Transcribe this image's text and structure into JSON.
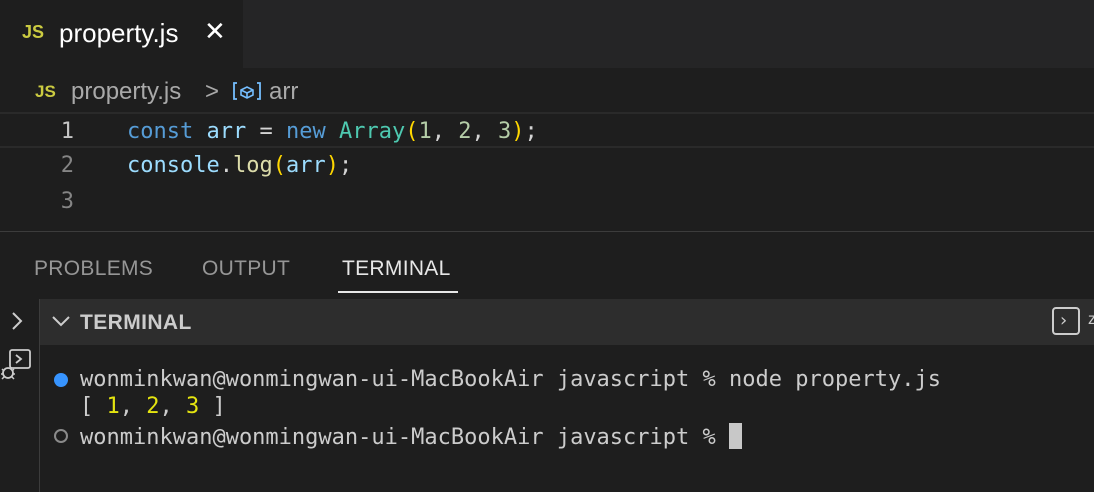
{
  "tab": {
    "lang_badge": "JS",
    "filename": "property.js",
    "close_glyph": "✕"
  },
  "breadcrumb": {
    "lang_badge": "JS",
    "file": "property.js",
    "separator": ">",
    "symbol": "arr"
  },
  "editor": {
    "line_numbers": [
      "1",
      "2",
      "3"
    ],
    "line1": {
      "kw_const": "const",
      "var_arr": "arr",
      "op_eq": "=",
      "kw_new": "new",
      "cls_array": "Array",
      "paren_open": "(",
      "n1": "1",
      "comma1": ", ",
      "n2": "2",
      "comma2": ", ",
      "n3": "3",
      "paren_close": ")",
      "semi": ";"
    },
    "line2": {
      "obj": "console",
      "dot": ".",
      "fn": "log",
      "paren_open": "(",
      "arg": "arr",
      "paren_close": ")",
      "semi": ";"
    }
  },
  "panel": {
    "tabs": [
      "PROBLEMS",
      "OUTPUT",
      "TERMINAL"
    ],
    "active_tab": "TERMINAL",
    "terminal_title": "TERMINAL",
    "more_glyph": "z"
  },
  "terminal": {
    "line1": "wonminkwan@wonmingwan-ui-MacBookAir javascript % node property.js",
    "out_open": "[ ",
    "out_1": "1",
    "out_sep1": ", ",
    "out_2": "2",
    "out_sep2": ", ",
    "out_3": "3",
    "out_close": " ]",
    "prompt": "wonminkwan@wonmingwan-ui-MacBookAir javascript % "
  },
  "colors": {
    "accent_blue": "#3794ff",
    "js_yellow": "#cbcb41"
  }
}
